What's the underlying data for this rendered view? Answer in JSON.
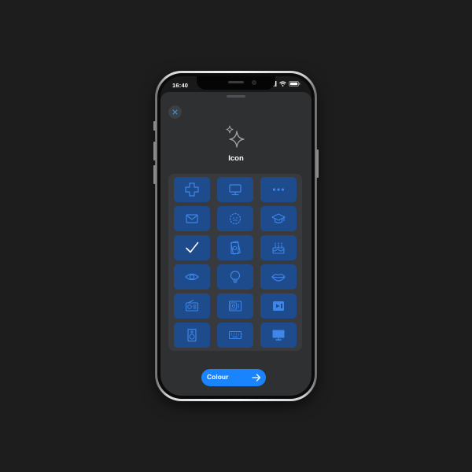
{
  "status_bar": {
    "time": "16:40"
  },
  "sheet": {
    "title": "Icon",
    "close_icon": "xmark-icon",
    "header_icon": "sparkles-icon"
  },
  "icon_grid": [
    "plus-icon",
    "desktop-icon",
    "ellipsis-icon",
    "envelope-icon",
    "face-icon",
    "graduation-cap-icon",
    "checkmark-icon",
    "money-icon",
    "cake-icon",
    "eye-icon",
    "lightbulb-icon",
    "lips-icon",
    "radio-icon",
    "safe-icon",
    "video-player-icon",
    "speaker-icon",
    "keyboard-icon",
    "tv-icon"
  ],
  "selected_icon": "checkmark-icon",
  "footer": {
    "next_label": "Colour",
    "next_icon": "arrow-right-icon"
  },
  "colors": {
    "accent": "#1a84ff",
    "tile": "#1d4b8c",
    "icon_stroke": "#3f86e8",
    "sheet": "#2f3032",
    "panel": "#393a3e"
  }
}
